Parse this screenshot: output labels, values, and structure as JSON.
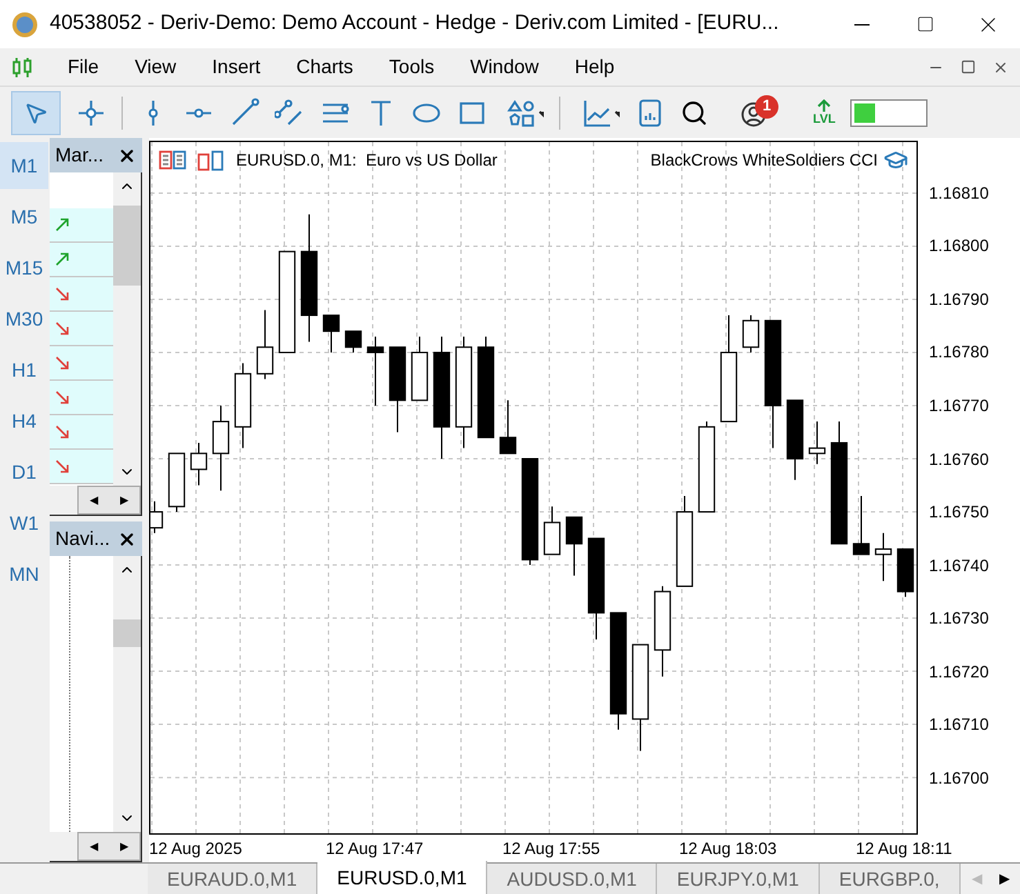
{
  "window": {
    "title": "40538052 - Deriv-Demo: Demo Account - Hedge - Deriv.com Limited - [EURU..."
  },
  "menu": [
    "File",
    "View",
    "Insert",
    "Charts",
    "Tools",
    "Window",
    "Help"
  ],
  "toolbar": {
    "notifications": "1",
    "level_label": "LVL",
    "level": 0.3
  },
  "timeframes": [
    {
      "label": "M1",
      "selected": true
    },
    {
      "label": "M5",
      "selected": false
    },
    {
      "label": "M15",
      "selected": false
    },
    {
      "label": "M30",
      "selected": false
    },
    {
      "label": "H1",
      "selected": false
    },
    {
      "label": "H4",
      "selected": false
    },
    {
      "label": "D1",
      "selected": false
    },
    {
      "label": "W1",
      "selected": false
    },
    {
      "label": "MN",
      "selected": false
    }
  ],
  "market_watch": {
    "title": "Mar...",
    "rows": [
      {
        "kind": "up"
      },
      {
        "kind": "up"
      },
      {
        "kind": "down"
      },
      {
        "kind": "down"
      },
      {
        "kind": "down"
      },
      {
        "kind": "down"
      },
      {
        "kind": "down"
      },
      {
        "kind": "down"
      }
    ]
  },
  "navigator": {
    "title": "Navi..."
  },
  "chart": {
    "symbol": "EURUSD.0, M1:  Euro vs US Dollar",
    "indicators": "BlackCrows WhiteSoldiers CCI",
    "chart_data": {
      "type": "candlestick",
      "categories": [
        null,
        null,
        null,
        null,
        null,
        null,
        null,
        null,
        null,
        null,
        null,
        null,
        null,
        null,
        null,
        null,
        null,
        null,
        null,
        null,
        null,
        null,
        null,
        null,
        null,
        null,
        null,
        null,
        null,
        null,
        null,
        null,
        null,
        null,
        null
      ],
      "ohlc": [
        [
          1.16747,
          1.16752,
          1.16746,
          1.1675
        ],
        [
          1.16751,
          1.16761,
          1.1675,
          1.16761
        ],
        [
          1.16758,
          1.16763,
          1.16755,
          1.16761
        ],
        [
          1.16761,
          1.1677,
          1.16754,
          1.16767
        ],
        [
          1.16766,
          1.16778,
          1.16762,
          1.16776
        ],
        [
          1.16776,
          1.16788,
          1.16775,
          1.16781
        ],
        [
          1.1678,
          1.16799,
          1.1678,
          1.16799
        ],
        [
          1.16799,
          1.16806,
          1.16782,
          1.16787
        ],
        [
          1.16787,
          1.16787,
          1.1678,
          1.16784
        ],
        [
          1.16784,
          1.16784,
          1.1678,
          1.16781
        ],
        [
          1.16781,
          1.16783,
          1.1677,
          1.1678
        ],
        [
          1.16781,
          1.16781,
          1.16765,
          1.16771
        ],
        [
          1.16771,
          1.16783,
          1.16771,
          1.1678
        ],
        [
          1.1678,
          1.16783,
          1.1676,
          1.16766
        ],
        [
          1.16766,
          1.16783,
          1.16762,
          1.16781
        ],
        [
          1.16781,
          1.16783,
          1.16764,
          1.16764
        ],
        [
          1.16764,
          1.16771,
          1.16761,
          1.16761
        ],
        [
          1.1676,
          1.1676,
          1.1674,
          1.16741
        ],
        [
          1.16742,
          1.16751,
          1.16742,
          1.16748
        ],
        [
          1.16749,
          1.16749,
          1.16738,
          1.16744
        ],
        [
          1.16745,
          1.16745,
          1.16726,
          1.16731
        ],
        [
          1.16731,
          1.16731,
          1.16709,
          1.16712
        ],
        [
          1.16711,
          1.16725,
          1.16705,
          1.16725
        ],
        [
          1.16724,
          1.16736,
          1.16719,
          1.16735
        ],
        [
          1.16736,
          1.16753,
          1.16736,
          1.1675
        ],
        [
          1.1675,
          1.16767,
          1.1675,
          1.16766
        ],
        [
          1.16767,
          1.16787,
          1.16767,
          1.1678
        ],
        [
          1.16781,
          1.16787,
          1.1678,
          1.16786
        ],
        [
          1.16786,
          1.16786,
          1.16762,
          1.1677
        ],
        [
          1.16771,
          1.16771,
          1.16756,
          1.1676
        ],
        [
          1.16761,
          1.16767,
          1.16759,
          1.16762
        ],
        [
          1.16763,
          1.16767,
          1.16744,
          1.16744
        ],
        [
          1.16744,
          1.16753,
          1.16742,
          1.16742
        ],
        [
          1.16742,
          1.16746,
          1.16737,
          1.16743
        ],
        [
          1.16743,
          1.16743,
          1.16734,
          1.16735
        ]
      ],
      "ylim": [
        1.166895,
        1.168196
      ],
      "grid": true,
      "yticks": [
        {
          "value": 1.1681,
          "label": "1.16810"
        },
        {
          "value": 1.168,
          "label": "1.16800"
        },
        {
          "value": 1.1679,
          "label": "1.16790"
        },
        {
          "value": 1.1678,
          "label": "1.16780"
        },
        {
          "value": 1.1677,
          "label": "1.16770"
        },
        {
          "value": 1.1676,
          "label": "1.16760"
        },
        {
          "value": 1.1675,
          "label": "1.16750"
        },
        {
          "value": 1.1674,
          "label": "1.16740"
        },
        {
          "value": 1.1673,
          "label": "1.16730"
        },
        {
          "value": 1.1672,
          "label": "1.16720"
        },
        {
          "value": 1.1671,
          "label": "1.16710"
        },
        {
          "value": 1.167,
          "label": "1.16700"
        }
      ]
    },
    "time_axis": [
      "12 Aug 2025",
      "12 Aug 17:47",
      "12 Aug 17:55",
      "12 Aug 18:03",
      "12 Aug 18:11"
    ]
  },
  "scroll_arrows": {
    "left": "◀",
    "right": "▶"
  },
  "tabs": [
    {
      "label": "EURAUD.0,M1",
      "selected": false
    },
    {
      "label": "EURUSD.0,M1",
      "selected": true
    },
    {
      "label": "AUDUSD.0,M1",
      "selected": false
    },
    {
      "label": "EURJPY.0,M1",
      "selected": false
    },
    {
      "label": "EURGBP.0,",
      "selected": false
    }
  ]
}
